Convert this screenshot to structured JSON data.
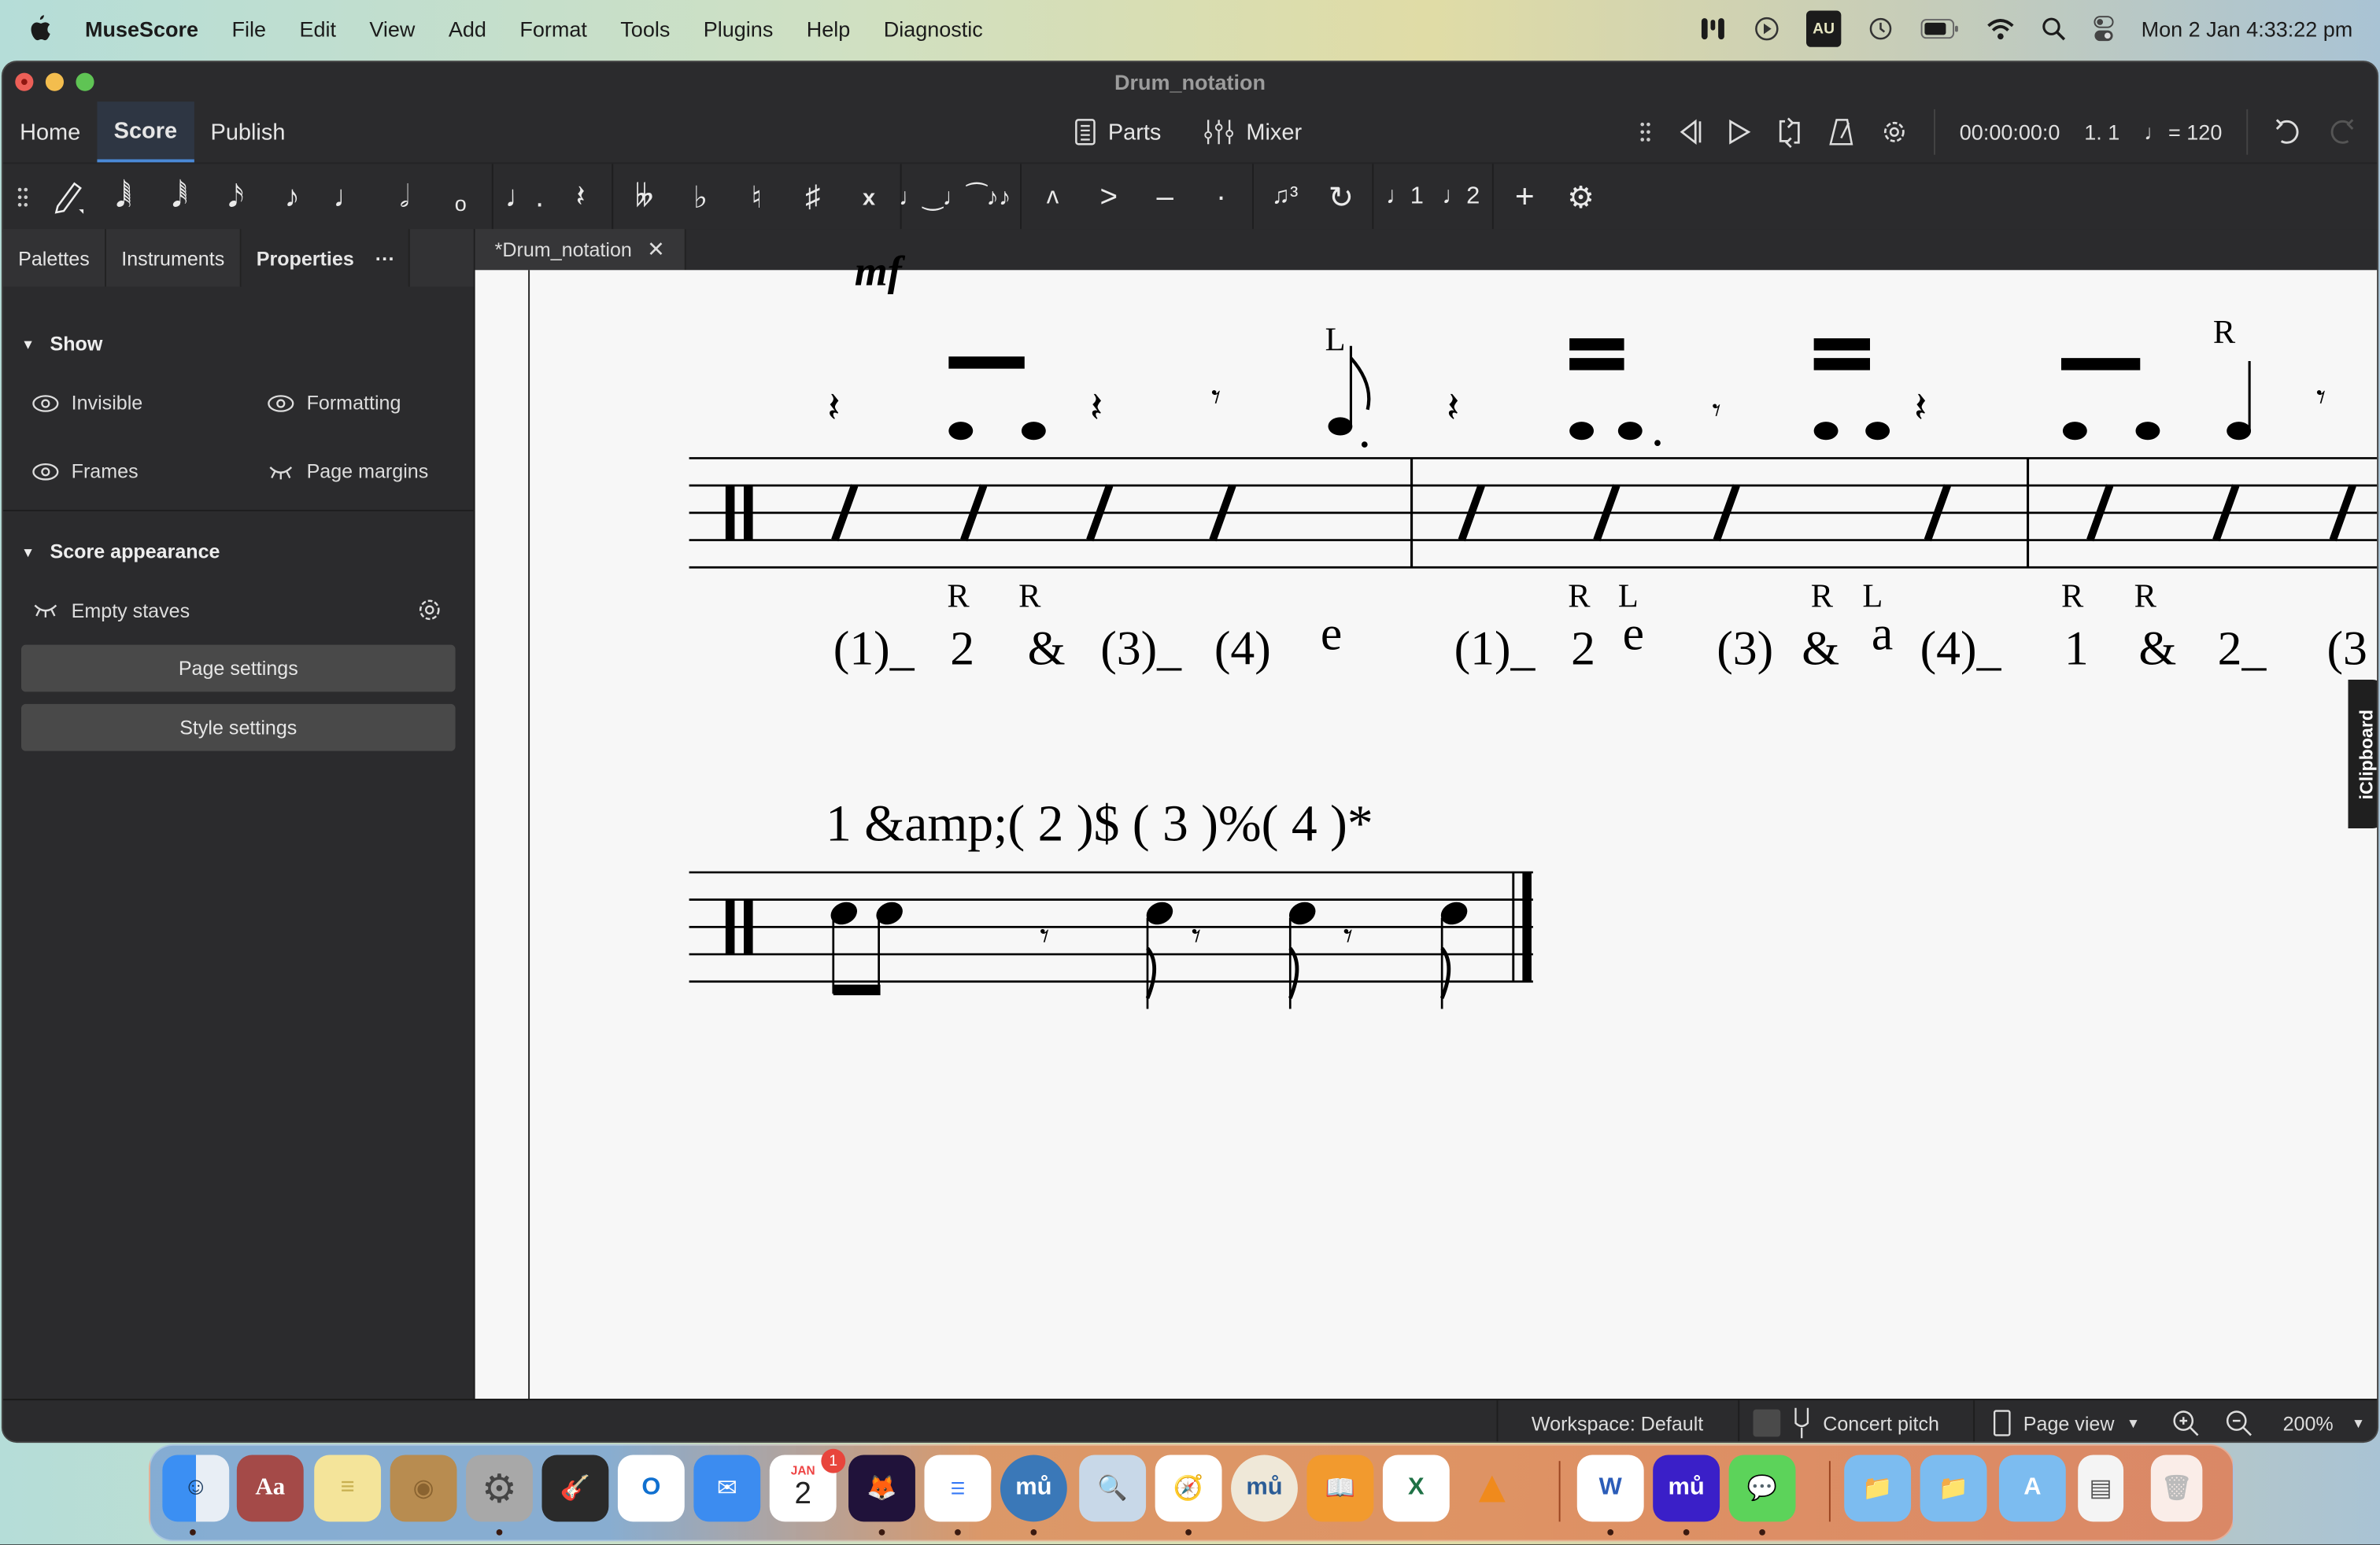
{
  "menubar": {
    "app_name": "MuseScore",
    "items": [
      "File",
      "Edit",
      "View",
      "Add",
      "Format",
      "Tools",
      "Plugins",
      "Help",
      "Diagnostic"
    ],
    "status_icons": [
      "stage-manager-icon",
      "play-circle-icon",
      "input-source-icon",
      "time-machine-icon",
      "battery-icon",
      "wifi-icon",
      "spotlight-search-icon",
      "control-center-icon"
    ],
    "input_source": "AU",
    "datetime": "Mon 2 Jan  4:33:22 pm"
  },
  "window": {
    "title": "Drum_notation"
  },
  "topnav": {
    "tabs": [
      {
        "label": "Home",
        "active": false
      },
      {
        "label": "Score",
        "active": true
      },
      {
        "label": "Publish",
        "active": false
      }
    ],
    "parts_label": "Parts",
    "mixer_label": "Mixer",
    "time": "00:00:00:0",
    "position": "1. 1",
    "tempo": "= 120"
  },
  "note_toolbar": {
    "groups": [
      [
        "note-input-pencil",
        "64th-note",
        "32nd-note",
        "16th-note",
        "8th-note",
        "quarter-note",
        "half-note",
        "whole-note"
      ],
      [
        "augmentation-dot",
        "rest"
      ],
      [
        "double-flat",
        "flat",
        "natural",
        "sharp",
        "double-sharp"
      ],
      [
        "tie",
        "slur"
      ],
      [
        "marcato",
        "accent",
        "tenuto",
        "staccato"
      ],
      [
        "tuplet",
        "flip-direction"
      ],
      [
        "voice-1",
        "voice-2"
      ],
      [
        "add",
        "customize-toolbar"
      ]
    ]
  },
  "panel": {
    "tabs": [
      {
        "label": "Palettes",
        "active": false
      },
      {
        "label": "Instruments",
        "active": false
      },
      {
        "label": "Properties",
        "active": true
      }
    ],
    "more_label": "···",
    "show_section": {
      "title": "Show",
      "items": [
        {
          "label": "Invisible",
          "visible": true
        },
        {
          "label": "Formatting",
          "visible": true
        },
        {
          "label": "Frames",
          "visible": true
        },
        {
          "label": "Page margins",
          "visible": false
        }
      ]
    },
    "appearance_section": {
      "title": "Score appearance",
      "empty_staves_label": "Empty staves",
      "page_settings_label": "Page settings",
      "style_settings_label": "Style settings"
    }
  },
  "document": {
    "tab_label": "*Drum_notation",
    "system1": {
      "dynamic": "mf",
      "sticking_above": [
        "L",
        "R"
      ],
      "sticking_below": [
        "R",
        "R",
        "R",
        "L",
        "R",
        "L",
        "R",
        "R"
      ],
      "counts_m1": [
        "(1)_",
        "2",
        "&",
        "(3)_",
        "(4)",
        "e"
      ],
      "counts_m2": [
        "(1)_",
        "2",
        "e",
        "(3)",
        "&",
        "a",
        "(4)_"
      ],
      "counts_m3": [
        "1",
        "&",
        "2_",
        "(3"
      ]
    },
    "system2": {
      "counts": "1  &amp;( 2 )$  ( 3 )%( 4 )*"
    },
    "side_widget": "iClipboard"
  },
  "statusbar": {
    "workspace": "Workspace: Default",
    "concert_pitch_label": "Concert pitch",
    "concert_pitch_checked": false,
    "view_mode": "Page view",
    "zoom": "200%"
  },
  "dock": {
    "apps": [
      "Finder",
      "Dictionary",
      "Stickies",
      "Contacts",
      "System Preferences",
      "GarageBand",
      "Outlook",
      "Mail",
      "Calendar",
      "Firefox",
      "Reminders",
      "MuseScore",
      "Preview",
      "Safari",
      "MuseScore 3",
      "Books",
      "Excel",
      "VLC",
      "Word",
      "MuseScore 4",
      "Messages",
      "Folder",
      "Downloads",
      "Applications",
      "Document",
      "Trash"
    ],
    "calendar_month": "JAN",
    "calendar_day": "2",
    "calendar_badge": "1"
  }
}
